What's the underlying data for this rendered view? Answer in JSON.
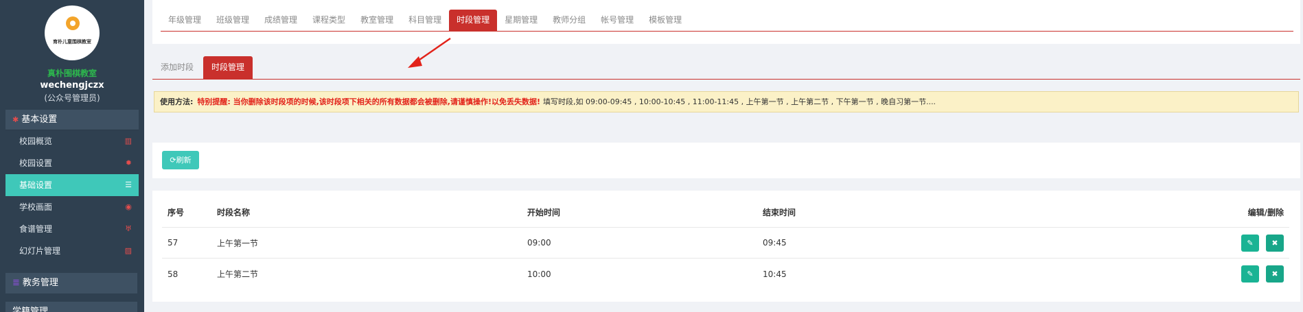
{
  "sidebar": {
    "logo_text": "育朴儿童围棋教室",
    "school_name": "真朴围棋教室",
    "username": "wechengjczx",
    "role": "(公众号管理员)",
    "group1": "基本设置",
    "items": [
      {
        "label": "校园概览",
        "icon": "bank-icon"
      },
      {
        "label": "校园设置",
        "icon": "gear-icon"
      },
      {
        "label": "基础设置",
        "icon": "bars-icon"
      },
      {
        "label": "学校画面",
        "icon": "eye-icon"
      },
      {
        "label": "食谱管理",
        "icon": "cutlery-icon"
      },
      {
        "label": "幻灯片管理",
        "icon": "image-icon"
      }
    ],
    "group2": "教务管理",
    "group3": "学籍管理"
  },
  "topnav": {
    "tabs": [
      "年级管理",
      "班级管理",
      "成绩管理",
      "课程类型",
      "教室管理",
      "科目管理",
      "时段管理",
      "星期管理",
      "教师分组",
      "帐号管理",
      "模板管理"
    ],
    "active": "时段管理"
  },
  "subtabs": {
    "add": "添加时段",
    "manage": "时段管理"
  },
  "notice": {
    "label": "使用方法:",
    "warning": "特别提醒: 当你删除该时段项的时候,该时段项下相关的所有数据都会被删除,请谨慎操作!以免丢失数据!",
    "text": "填写时段,如 09:00-09:45 , 10:00-10:45 , 11:00-11:45 , 上午第一节 , 上午第二节 , 下午第一节 , 晚自习第一节...."
  },
  "refresh_label": "刷新",
  "table": {
    "headers": [
      "序号",
      "时段名称",
      "开始时间",
      "结束时间",
      "编辑/删除"
    ],
    "rows": [
      {
        "id": "57",
        "name": "上午第一节",
        "start": "09:00",
        "end": "09:45"
      },
      {
        "id": "58",
        "name": "上午第二节",
        "start": "10:00",
        "end": "10:45"
      }
    ]
  },
  "colors": {
    "accent": "#c9302c",
    "teal": "#3fc8b9",
    "sidebar": "#2f4050"
  }
}
